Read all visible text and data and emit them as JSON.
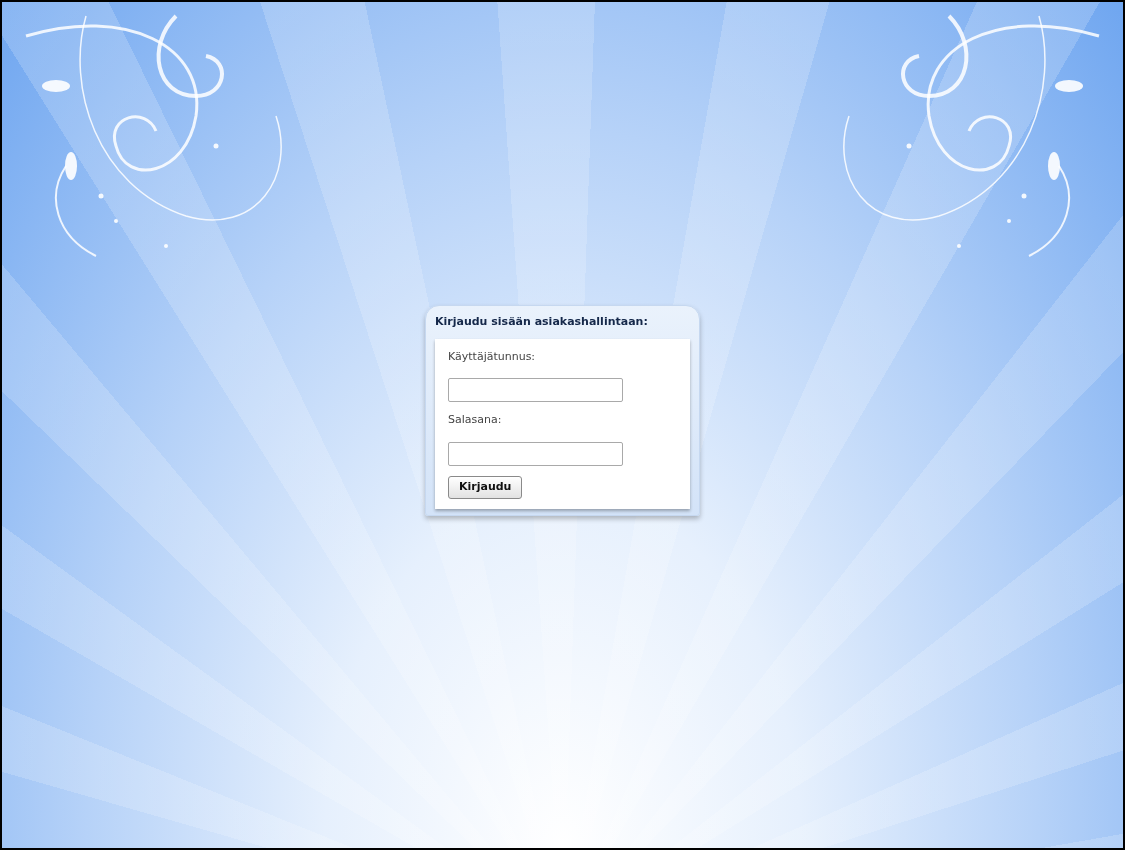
{
  "login": {
    "title": "Kirjaudu sisään asiakashallintaan:",
    "fields": [
      {
        "label": "Käyttäjätunnus:"
      },
      {
        "label": "Salasana:"
      }
    ],
    "button": "Kirjaudu"
  }
}
